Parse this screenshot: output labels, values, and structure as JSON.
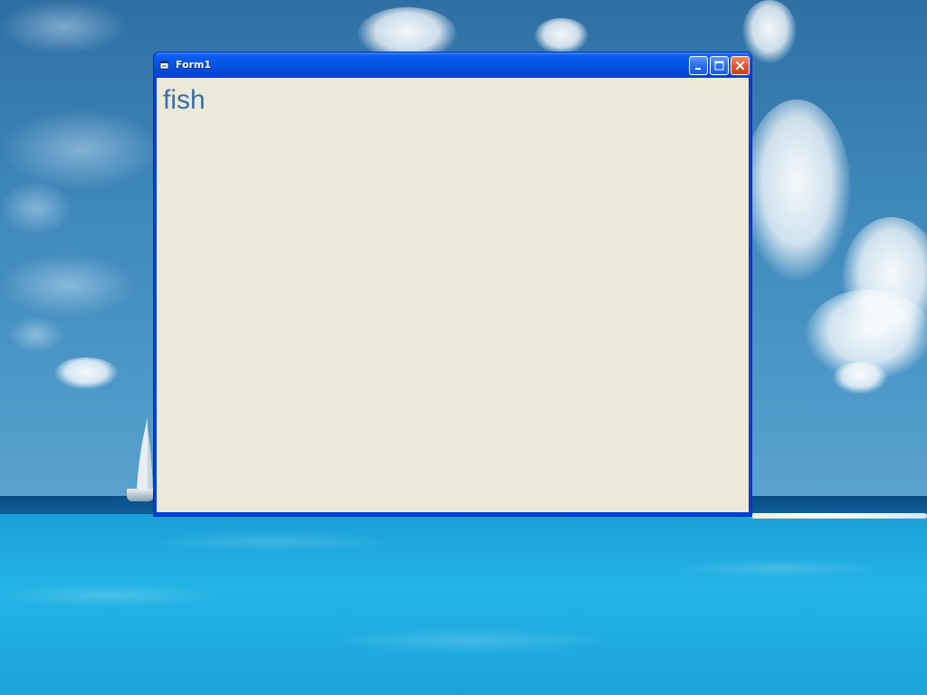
{
  "window": {
    "title": "Form1",
    "icon": "form-icon",
    "buttons": {
      "minimize_icon": "minimize-icon",
      "maximize_icon": "maximize-icon",
      "close_icon": "close-icon"
    }
  },
  "form": {
    "label_text": "fish"
  },
  "colors": {
    "titlebar": "#0553e3",
    "client_background": "#ece9d8",
    "label_text": "#3a6ea8"
  }
}
